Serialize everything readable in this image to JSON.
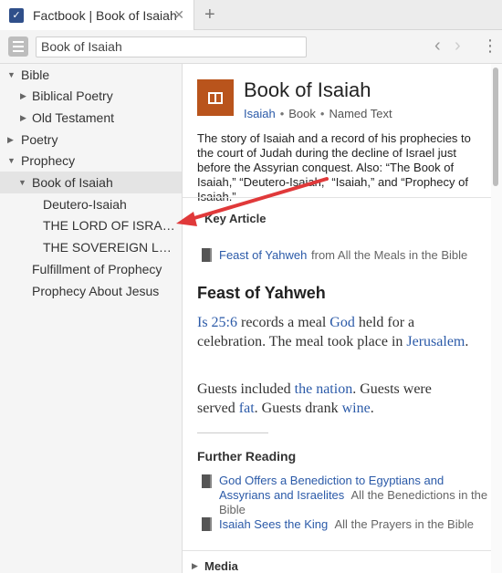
{
  "tab": {
    "title": "Factbook | Book of Isaiah",
    "close": "✕",
    "add": "+"
  },
  "toolbar": {
    "search_value": "Book of Isaiah",
    "back": "‹",
    "forward": "›",
    "more": "⋮"
  },
  "sidebar": {
    "items": [
      {
        "label": "Bible",
        "caret": "▼"
      },
      {
        "label": "Biblical Poetry",
        "caret": "▶"
      },
      {
        "label": "Old Testament",
        "caret": "▶"
      },
      {
        "label": "Poetry",
        "caret": "▶"
      },
      {
        "label": "Prophecy",
        "caret": "▼"
      },
      {
        "label": "Book of Isaiah",
        "caret": "▼"
      },
      {
        "label": "Deutero-Isaiah"
      },
      {
        "label": "THE LORD OF ISRAEL A…"
      },
      {
        "label": "THE SOVEREIGN LORD …"
      },
      {
        "label": "Fulfillment of Prophecy"
      },
      {
        "label": "Prophecy About Jesus"
      }
    ]
  },
  "header": {
    "title": "Book of Isaiah",
    "meta_link": "Isaiah",
    "meta_type": "Book",
    "meta_kind": "Named Text",
    "dot": "•",
    "summary": "The story of Isaiah and a record of his prophecies to the court of Judah during the decline of Israel just before the Assyrian conquest. Also: “The Book of Isaiah,” “Deutero-Isaiah,” “Isaiah,” and “Prophecy of Isaiah.”"
  },
  "key_article": {
    "heading": "Key Article",
    "link": "Feast of Yahweh",
    "source": "from All the Meals in the Bible"
  },
  "article": {
    "title": "Feast of Yahweh",
    "p1": {
      "ref": "Is 25:6",
      "t1": " records a meal ",
      "god": "God",
      "t2": " held for a celebration. The meal took place in ",
      "place": "Jerusalem",
      "t3": "."
    },
    "p2": {
      "t1": "Guests included ",
      "nation": "the nation",
      "t2": ". Guests were served ",
      "fat": "fat",
      "t3": ". Guests drank ",
      "wine": "wine",
      "t4": "."
    }
  },
  "further": {
    "heading": "Further Reading",
    "items": [
      {
        "link": "God Offers a Benediction to Egyptians and Assyrians and Israelites",
        "source": "All the Benedictions in the Bible"
      },
      {
        "link": "Isaiah Sees the King",
        "source": "All the Prayers in the Bible"
      }
    ]
  },
  "media": {
    "heading": "Media",
    "caret": "▶"
  },
  "colors": {
    "link": "#2b5aa8",
    "book_icon": "#b9541c",
    "annotation_arrow": "#e0393a"
  }
}
